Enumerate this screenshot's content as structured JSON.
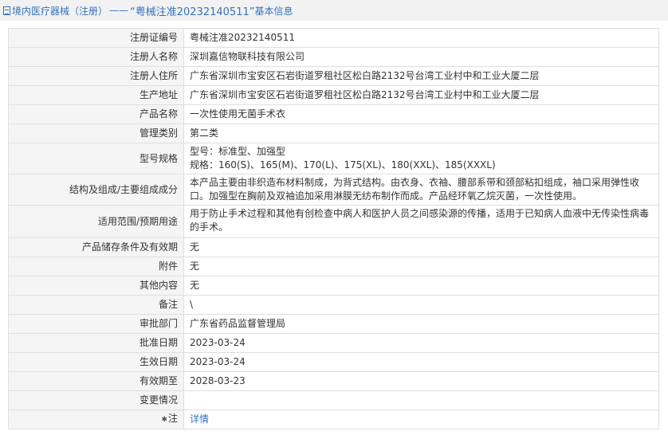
{
  "header": {
    "section": "境内医疗器械（注册）",
    "dash": "——",
    "reg_title": "“粤械注准20232140511”",
    "suffix": "基本信息"
  },
  "rows": [
    {
      "label": "注册证编号",
      "value": "粤械注准20232140511"
    },
    {
      "label": "注册人名称",
      "value": "深圳嘉信物联科技有限公司"
    },
    {
      "label": "注册人住所",
      "value": "广东省深圳市宝安区石岩街道罗租社区松白路2132号台湾工业村中和工业大厦二层"
    },
    {
      "label": "生产地址",
      "value": "广东省深圳市宝安区石岩街道罗租社区松白路2132号台湾工业村中和工业大厦二层"
    },
    {
      "label": "产品名称",
      "value": "一次性使用无菌手术衣"
    },
    {
      "label": "管理类别",
      "value": "第二类"
    },
    {
      "label": "型号规格",
      "line1": "型号：标准型、加强型",
      "line2": "规格：160(S)、165(M)、170(L)、175(XL)、180(XXL)、185(XXXL)"
    },
    {
      "label": "结构及组成/主要组成成分",
      "value": "本产品主要由非织造布材料制成，为背式结构。由衣身、衣袖、腰部系带和颈部粘扣组成，袖口采用弹性收口。加强型在胸前及双袖追加采用淋膜无纺布制作而成。产品经环氧乙烷灭菌，一次性使用。"
    },
    {
      "label": "适用范围/预期用途",
      "value": "用于防止手术过程和其他有创检查中病人和医护人员之间感染源的传播，适用于已知病人血液中无传染性病毒的手术。"
    },
    {
      "label": "产品储存条件及有效期",
      "value": "无"
    },
    {
      "label": "附件",
      "value": "无"
    },
    {
      "label": "其他内容",
      "value": "无"
    },
    {
      "label": "备注",
      "value": "\\"
    },
    {
      "label": "审批部门",
      "value": "广东省药品监督管理局"
    },
    {
      "label": "批准日期",
      "value": "2023-03-24"
    },
    {
      "label": "生效日期",
      "value": "2023-03-24"
    },
    {
      "label": "有效期至",
      "value": "2028-03-23"
    },
    {
      "label": "变更情况",
      "value": ""
    },
    {
      "label": "注",
      "value": "详情"
    }
  ],
  "icons": {
    "header": "document-icon",
    "note": "star-icon"
  }
}
